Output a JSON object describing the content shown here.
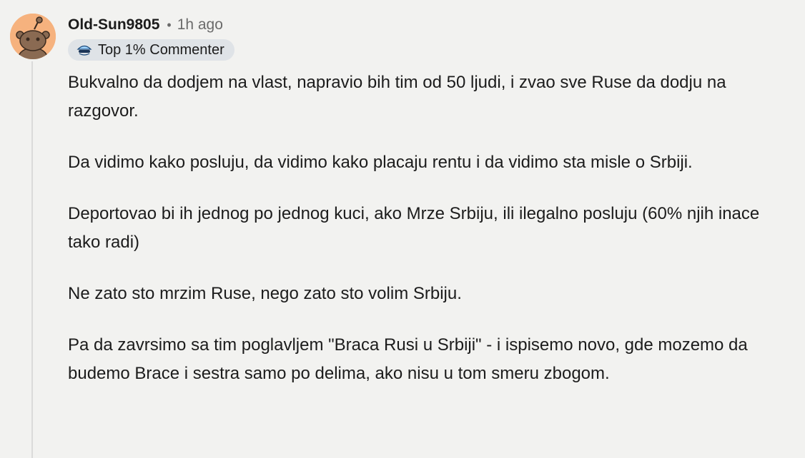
{
  "comment": {
    "author": "Old-Sun9805",
    "separator": "•",
    "time": "1h ago",
    "flair": {
      "icon": "top-commenter-icon",
      "label": "Top 1% Commenter"
    },
    "paragraphs": [
      "Bukvalno da dodjem na vlast, napravio bih tim od 50 ljudi, i zvao sve Ruse da dodju na razgovor.",
      "Da vidimo kako posluju, da vidimo kako placaju rentu i da vidimo sta misle o Srbiji.",
      "Deportovao bi ih jednog po jednog kuci, ako Mrze Srbiju, ili ilegalno posluju (60% njih inace tako radi)",
      "Ne zato sto mrzim Ruse, nego zato sto volim Srbiju.",
      "Pa da zavrsimo sa tim poglavljem \"Braca Rusi u Srbiji\" - i ispisemo novo, gde mozemo da budemo Brace i sestra samo po delima, ako nisu u tom smeru zbogom."
    ]
  },
  "colors": {
    "background": "#f2f2f0",
    "avatar_bg": "#f6b27e",
    "flair_bg": "#dfe3e7",
    "thread_line": "#dadada"
  }
}
